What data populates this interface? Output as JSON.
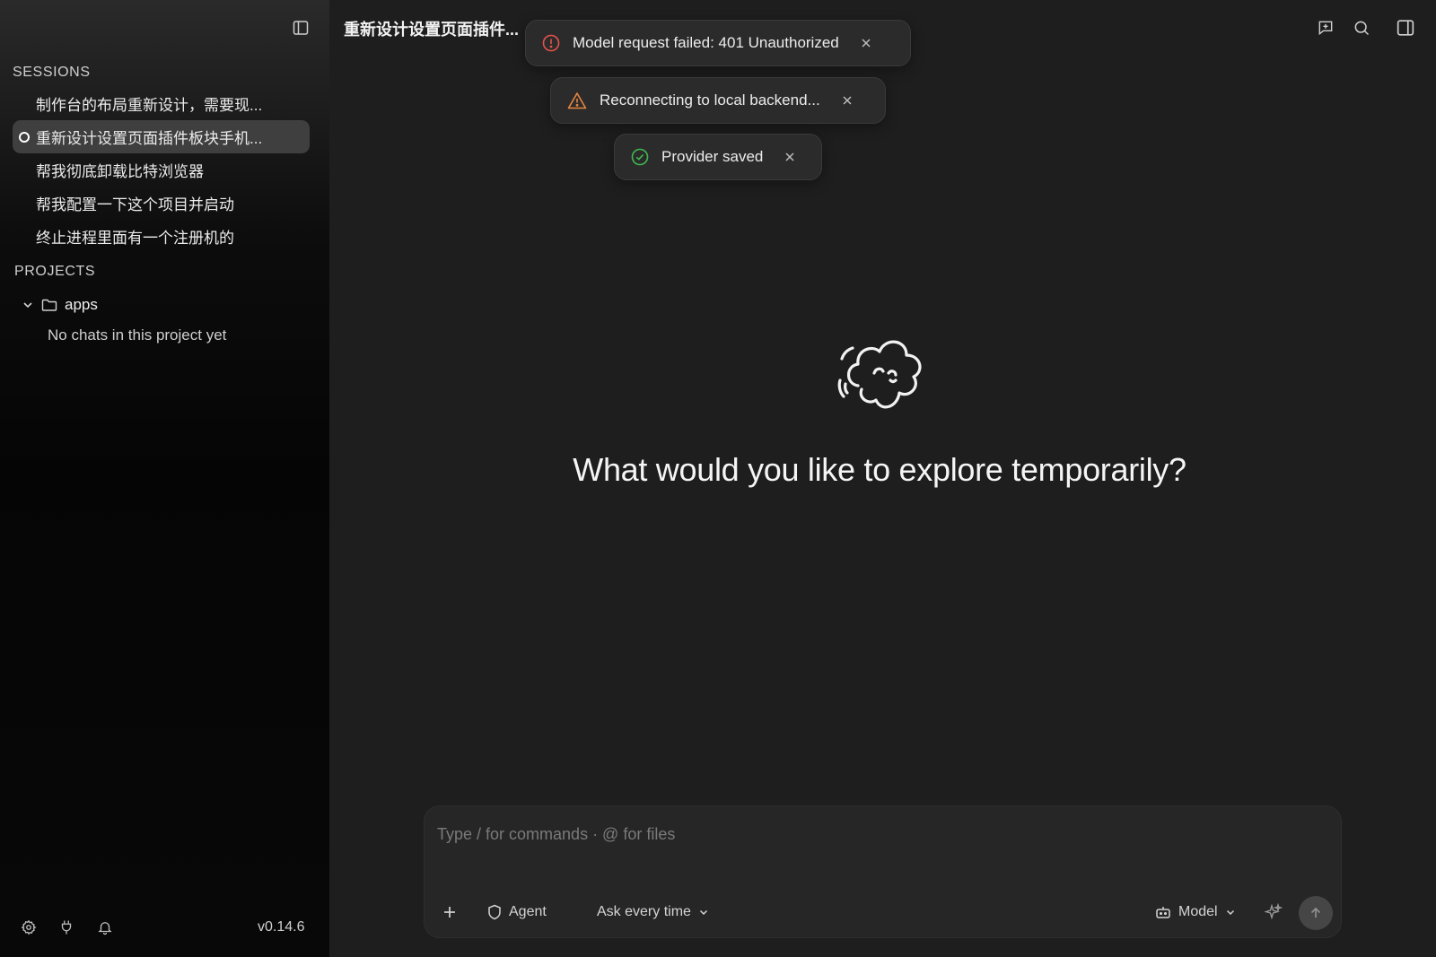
{
  "sidebar": {
    "sessions_title": "SESSIONS",
    "sessions": [
      {
        "label": "制作台的布局重新设计，需要现..."
      },
      {
        "label": "重新设计设置页面插件板块手机...",
        "active": true
      },
      {
        "label": "帮我彻底卸载比特浏览器"
      },
      {
        "label": "帮我配置一下这个项目并启动"
      },
      {
        "label": "终止进程里面有一个注册机的"
      }
    ],
    "projects_title": "PROJECTS",
    "project": {
      "name": "apps",
      "empty_text": "No chats in this project yet"
    },
    "footer": {
      "icons": [
        "gear-icon",
        "plug-icon",
        "bell-icon"
      ],
      "version": "v0.14.6"
    }
  },
  "header": {
    "title": "重新设计设置页面插件...",
    "icons": [
      "new-chat-icon",
      "search-icon",
      "panel-icon"
    ]
  },
  "toasts": [
    {
      "type": "error",
      "message": "Model request failed: 401 Unauthorized",
      "color": "#e5534b"
    },
    {
      "type": "warning",
      "message": "Reconnecting to local backend...",
      "color": "#e8853f"
    },
    {
      "type": "success",
      "message": "Provider saved",
      "color": "#3fb950"
    }
  ],
  "main": {
    "heading": "What would you like to explore temporarily?"
  },
  "composer": {
    "placeholder": "Type / for commands · @ for files",
    "agent_label": "Agent",
    "permission_label": "Ask every time",
    "model_label": "Model"
  }
}
